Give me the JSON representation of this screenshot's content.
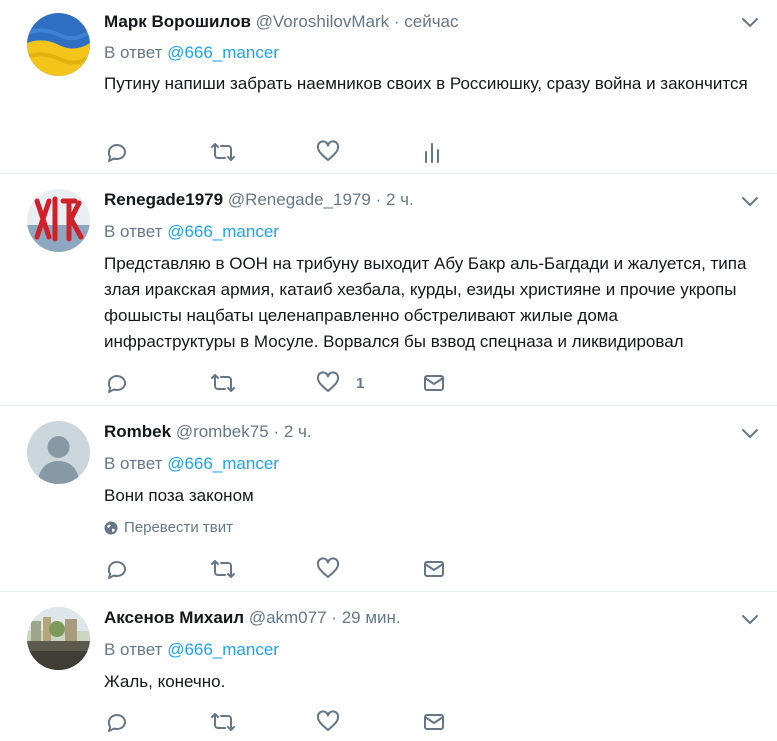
{
  "tweets": [
    {
      "name": "Марк Ворошилов",
      "handle": "@VoroshilovMark",
      "separator": "·",
      "time": "сейчас",
      "reply_prefix": "В ответ",
      "reply_to": "@666_mancer",
      "text": "Путину напиши забрать наемников своих в Россиюшку, сразу война и закончится",
      "avatar": "ukraine-flag",
      "last_action": "analytics-icon"
    },
    {
      "name": "Renegade1979",
      "handle": "@Renegade_1979",
      "separator": "·",
      "time": "2 ч.",
      "reply_prefix": "В ответ",
      "reply_to": "@666_mancer",
      "text": "Представляю в ООН на трибуну выходит Абу Бакр аль-Багдади и жалуется, типа злая иракская армия, катаиб хезбала, курды, езиды християне и прочие укропы фошысты нацбаты целенаправленно обстреливают жилые дома инфраструктуры в Мосуле. Ворвался бы взвод спецназа и ликвидировал",
      "like_count": "1",
      "avatar": "red-emblem",
      "last_action": "mail-icon"
    },
    {
      "name": "Rombek",
      "handle": "@rombek75",
      "separator": "·",
      "time": "2 ч.",
      "reply_prefix": "В ответ",
      "reply_to": "@666_mancer",
      "text": "Вони поза законом",
      "translate_label": "Перевести твит",
      "avatar": "default-person",
      "last_action": "mail-icon"
    },
    {
      "name": "Аксенов Михаил",
      "handle": "@akm077",
      "separator": "·",
      "time": "29 мин.",
      "reply_prefix": "В ответ",
      "reply_to": "@666_mancer",
      "text": "Жаль, конечно.",
      "avatar": "city-photo",
      "last_action": "mail-icon"
    }
  ],
  "colors": {
    "accent": "#1da1f2",
    "secondary_text": "#657786",
    "icon": "#657786",
    "divider": "#e6ecf0"
  }
}
